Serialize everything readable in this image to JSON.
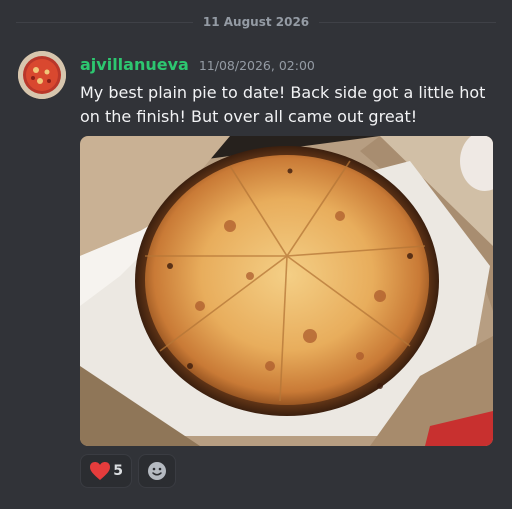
{
  "date_divider": "11 August 2026",
  "message": {
    "author": "ajvillanueva",
    "timestamp": "11/08/2026, 02:00",
    "text": "My best plain pie to date! Back side got a little hot on the finish! But over all came out great!",
    "username_color": "#2dc770"
  },
  "attachment": {
    "icon": "pizza-photo"
  },
  "reactions": [
    {
      "emoji": "heart-icon",
      "count": "5"
    },
    {
      "emoji": "add-reaction-icon"
    }
  ]
}
